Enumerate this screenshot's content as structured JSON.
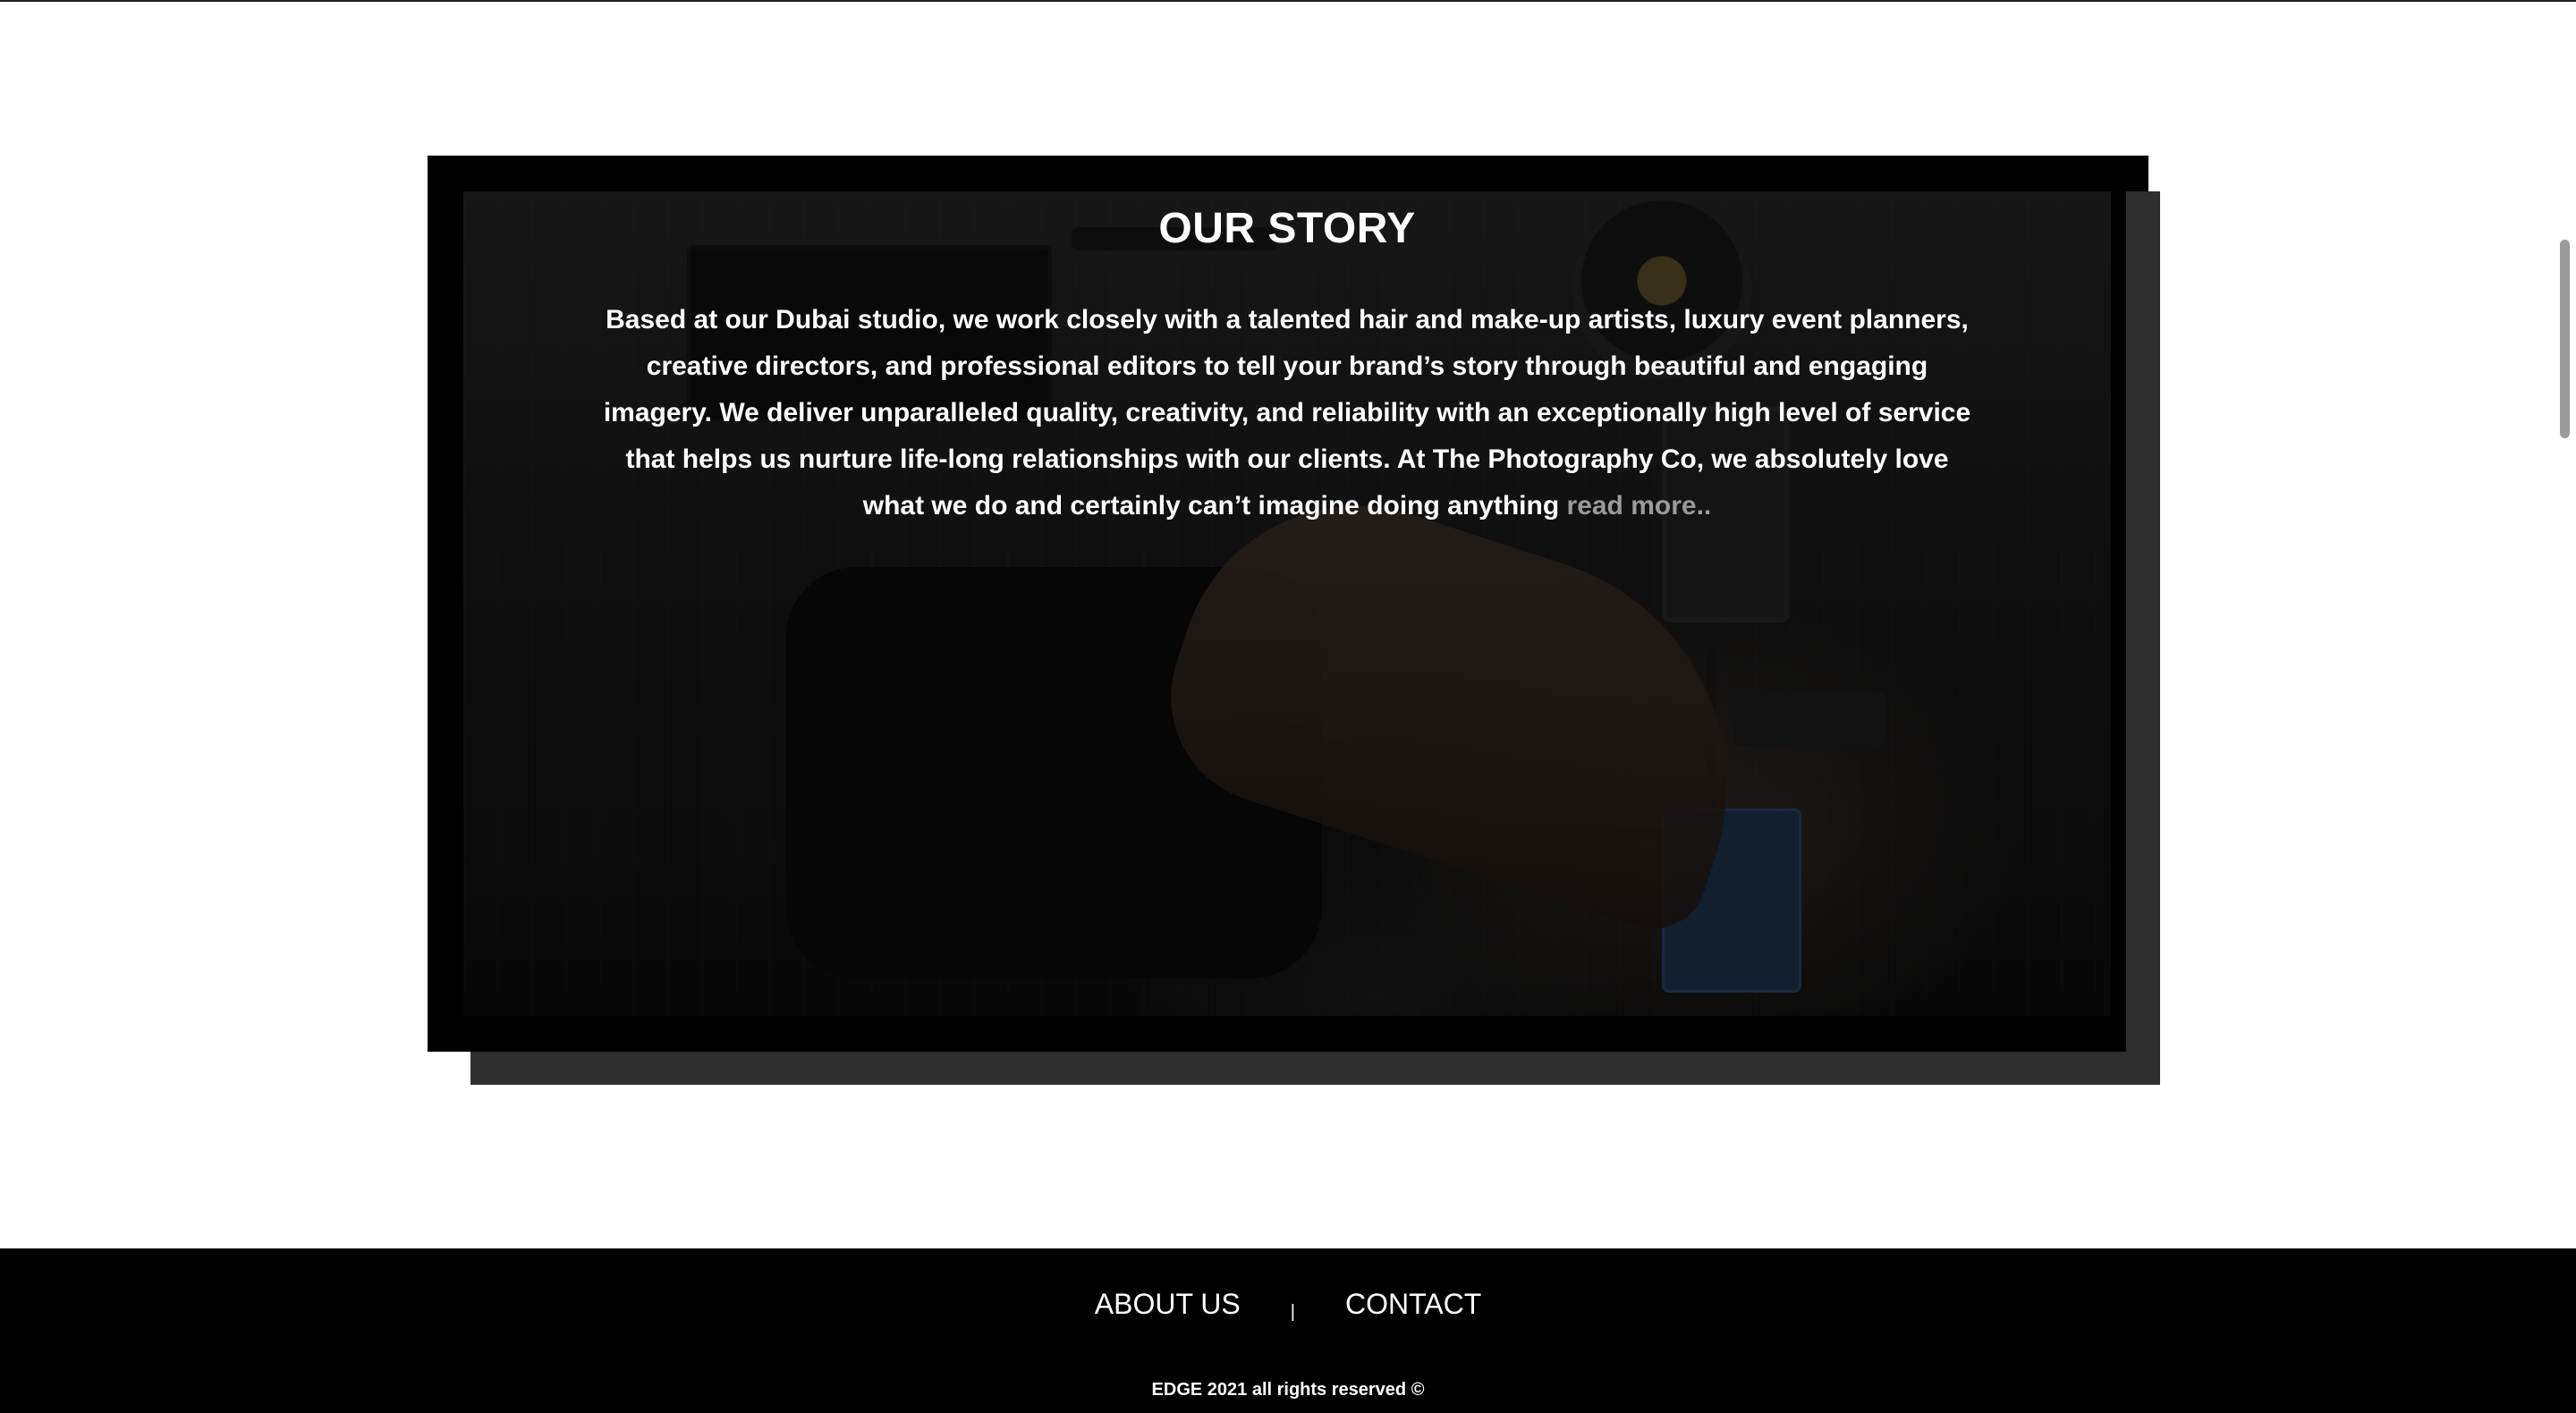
{
  "story": {
    "title": "OUR STORY",
    "body": "Based at our Dubai studio, we work closely with a talented hair and make-up artists, luxury event planners, creative directors, and professional editors to tell your brand’s story through beautiful and engaging imagery. We deliver unparalleled quality, creativity, and reliability with an exceptionally high level of service that helps us nurture life-long relationships with our clients. At The Photography Co, we absolutely love what we do and certainly can’t imagine doing anything",
    "read_more": "read more.."
  },
  "footer": {
    "nav": {
      "about": "ABOUT US",
      "separator": "|",
      "contact": "CONTACT"
    },
    "copyright": "EDGE 2021 all rights reserved ©"
  },
  "colors": {
    "background": "#ffffff",
    "frame": "#000000",
    "shadow": "#2f2f2f",
    "footer": "#000000",
    "text": "#ffffff",
    "link_muted": "#9a9a9a"
  }
}
